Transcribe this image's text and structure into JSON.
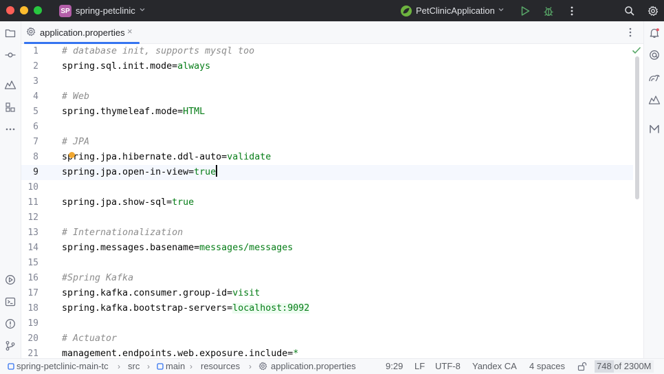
{
  "titlebar": {
    "project_badge": "SP",
    "project_name": "spring-petclinic",
    "run_config": "PetClinicApplication",
    "icons": [
      "run-icon",
      "debug-icon",
      "more-icon",
      "search-icon",
      "settings-icon"
    ],
    "colors": {
      "close": "#ff5f57",
      "minimize": "#febc2e",
      "maximize": "#28c840",
      "run": "#59a869",
      "badge": "#b35ea8"
    }
  },
  "left_toolbar": [
    "project-icon",
    "commit-icon",
    "services-icon",
    "structure-icon",
    "more-tools-icon",
    "run-tool-icon",
    "terminal-icon",
    "problems-icon",
    "git-icon"
  ],
  "right_toolbar": [
    "notifications-icon",
    "ai-assistant-icon",
    "gradle-icon",
    "maven-icon",
    "markdown-icon"
  ],
  "tab": {
    "label": "application.properties",
    "close": "×"
  },
  "editor": {
    "current_line": 9,
    "lines": [
      {
        "n": "1",
        "parts": [
          {
            "t": "# database init, supports mysql too",
            "c": "comment"
          }
        ]
      },
      {
        "n": "2",
        "parts": [
          {
            "t": "spring.sql.init.mode",
            "c": "key"
          },
          {
            "t": "=",
            "c": "eq"
          },
          {
            "t": "always",
            "c": "val"
          }
        ]
      },
      {
        "n": "3",
        "parts": []
      },
      {
        "n": "4",
        "parts": [
          {
            "t": "# Web",
            "c": "comment"
          }
        ]
      },
      {
        "n": "5",
        "parts": [
          {
            "t": "spring.thymeleaf.mode",
            "c": "key"
          },
          {
            "t": "=",
            "c": "eq"
          },
          {
            "t": "HTML",
            "c": "val"
          }
        ]
      },
      {
        "n": "6",
        "parts": []
      },
      {
        "n": "7",
        "parts": [
          {
            "t": "# JPA",
            "c": "comment"
          }
        ]
      },
      {
        "n": "8",
        "parts": [
          {
            "t": "spring.jpa.hibernate.ddl-auto",
            "c": "key"
          },
          {
            "t": "=",
            "c": "eq"
          },
          {
            "t": "validate",
            "c": "val"
          }
        ]
      },
      {
        "n": "9",
        "parts": [
          {
            "t": "spring.jpa.open-in-view",
            "c": "key"
          },
          {
            "t": "=",
            "c": "eq"
          },
          {
            "t": "true",
            "c": "val"
          }
        ]
      },
      {
        "n": "10",
        "parts": []
      },
      {
        "n": "11",
        "parts": [
          {
            "t": "spring.jpa.show-sql",
            "c": "key"
          },
          {
            "t": "=",
            "c": "eq"
          },
          {
            "t": "true",
            "c": "val"
          }
        ]
      },
      {
        "n": "12",
        "parts": []
      },
      {
        "n": "13",
        "parts": [
          {
            "t": "# Internationalization",
            "c": "comment"
          }
        ]
      },
      {
        "n": "14",
        "parts": [
          {
            "t": "spring.messages.basename",
            "c": "key"
          },
          {
            "t": "=",
            "c": "eq"
          },
          {
            "t": "messages/messages",
            "c": "val"
          }
        ]
      },
      {
        "n": "15",
        "parts": []
      },
      {
        "n": "16",
        "parts": [
          {
            "t": "#Spring Kafka",
            "c": "comment"
          }
        ]
      },
      {
        "n": "17",
        "parts": [
          {
            "t": "spring.kafka.consumer.group-id",
            "c": "key"
          },
          {
            "t": "=",
            "c": "eq"
          },
          {
            "t": "visit",
            "c": "val"
          }
        ]
      },
      {
        "n": "18",
        "parts": [
          {
            "t": "spring.kafka.bootstrap-servers",
            "c": "key"
          },
          {
            "t": "=",
            "c": "eq"
          },
          {
            "t": "localhost:9092",
            "c": "val-hl"
          }
        ]
      },
      {
        "n": "19",
        "parts": []
      },
      {
        "n": "20",
        "parts": [
          {
            "t": "# Actuator",
            "c": "comment"
          }
        ]
      },
      {
        "n": "21",
        "parts": [
          {
            "t": "management.endpoints.web.exposure.include",
            "c": "key"
          },
          {
            "t": "=",
            "c": "eq"
          },
          {
            "t": "*",
            "c": "val"
          }
        ]
      }
    ]
  },
  "statusbar": {
    "breadcrumbs": [
      "spring-petclinic-main-tc",
      "src",
      "main",
      "resources",
      "application.properties"
    ],
    "position": "9:29",
    "line_sep": "LF",
    "encoding": "UTF-8",
    "locale": "Yandex CA",
    "indent": "4 spaces",
    "memory_used": "748",
    "memory_text": "748 of 2300M",
    "memory_fraction": 0.325
  }
}
